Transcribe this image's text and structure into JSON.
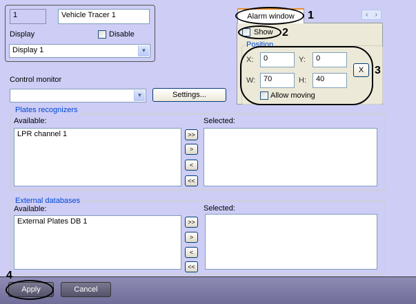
{
  "top": {
    "id_value": "1",
    "name_value": "Vehicle Tracer 1",
    "display_label": "Display",
    "disable_label": "Disable",
    "display_select": "Display 1"
  },
  "control": {
    "label": "Control monitor",
    "select_value": "",
    "settings_label": "Settings..."
  },
  "plates": {
    "title": "Plates recognizers",
    "available_label": "Available:",
    "selected_label": "Selected:",
    "available_items": [
      "LPR channel 1"
    ],
    "buttons": [
      ">>",
      ">",
      "<",
      "<<"
    ]
  },
  "external": {
    "title": "External databases",
    "available_label": "Available:",
    "selected_label": "Selected:",
    "available_items": [
      "External Plates DB 1"
    ],
    "buttons": [
      ">>",
      ">",
      "<",
      "<<"
    ]
  },
  "alarm": {
    "tab_label": "Alarm window",
    "show_label": "Show",
    "position_label": "Position",
    "x_label": "X:",
    "x_value": "0",
    "y_label": "Y:",
    "y_value": "0",
    "w_label": "W:",
    "w_value": "70",
    "h_label": "H:",
    "h_value": "40",
    "reset_label": "X",
    "allow_moving_label": "Allow moving",
    "nav_left": "‹",
    "nav_right": "›"
  },
  "footer": {
    "apply_label": "Apply",
    "cancel_label": "Cancel"
  },
  "annotations": [
    "1",
    "2",
    "3",
    "4"
  ],
  "colors": {
    "background": "#cdcdf5",
    "panel": "#ece9d8",
    "footer": "#7d7ba5"
  }
}
